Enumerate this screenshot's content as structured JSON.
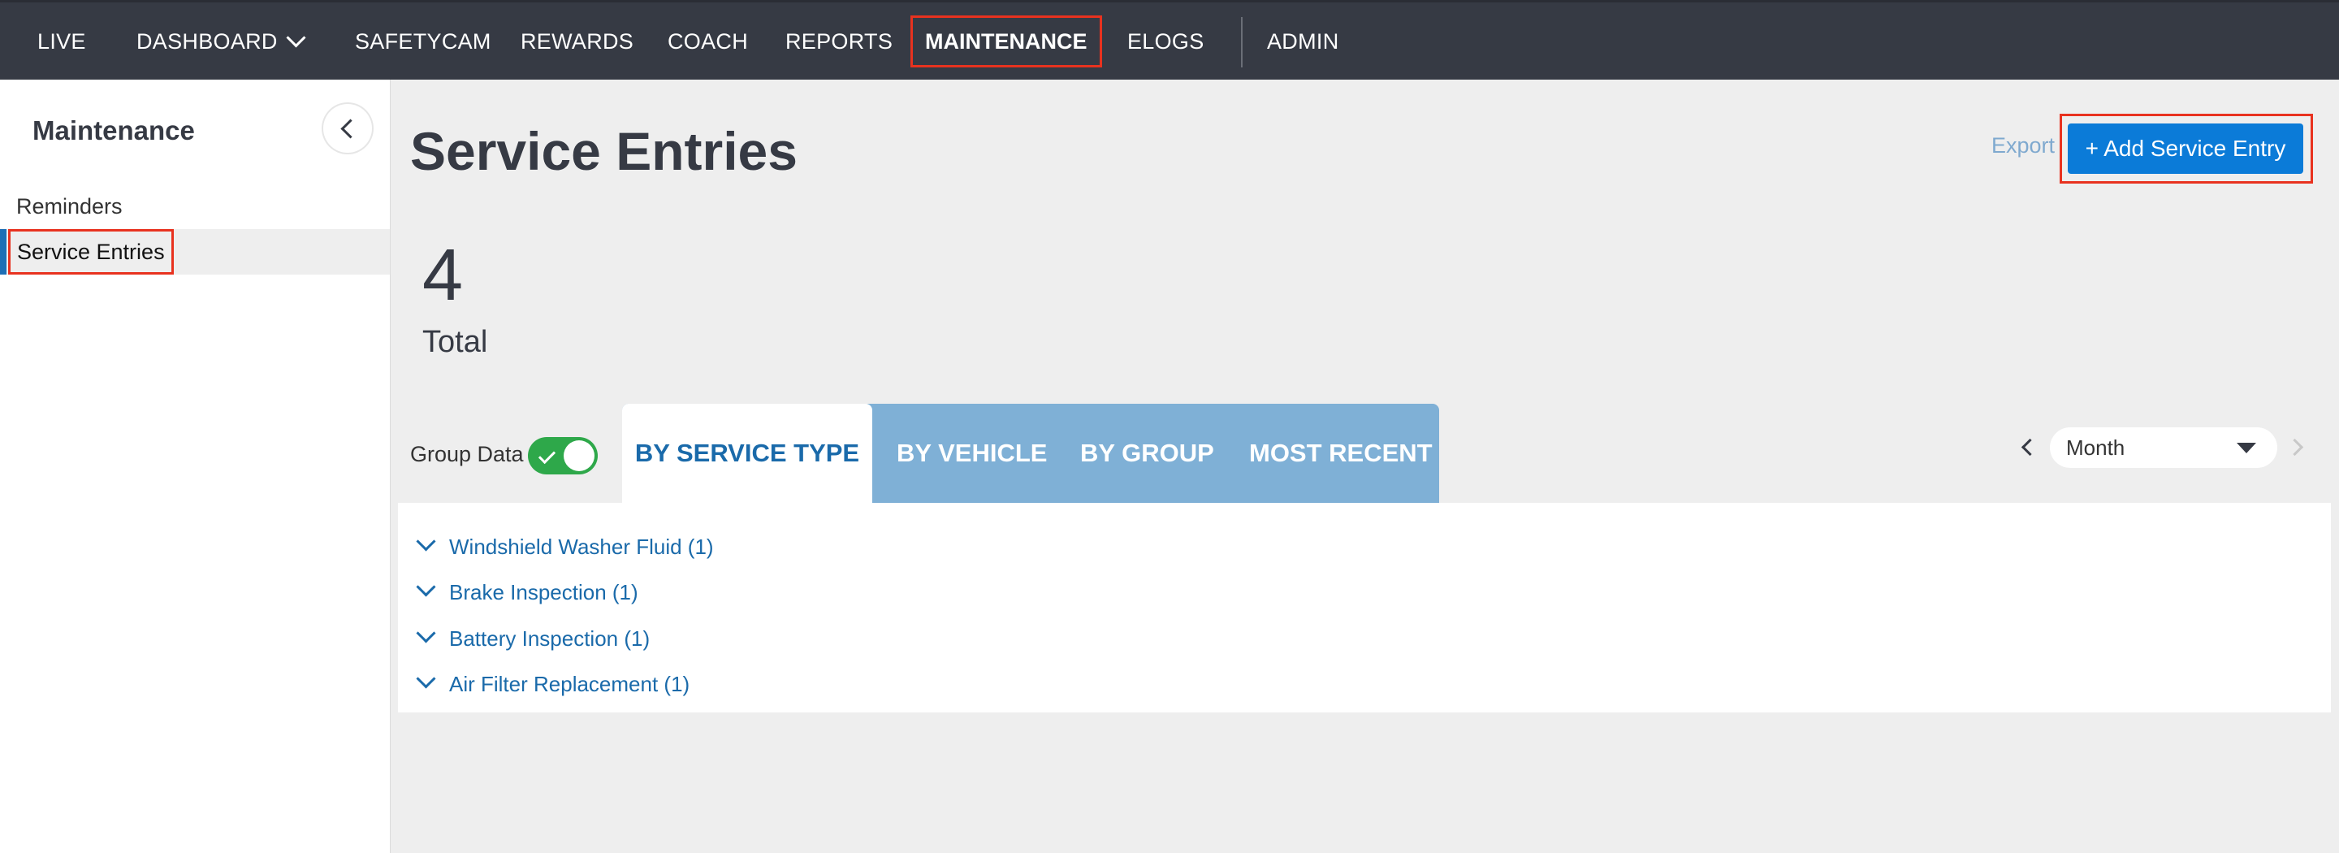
{
  "nav": {
    "items": [
      {
        "label": "LIVE"
      },
      {
        "label": "DASHBOARD"
      },
      {
        "label": "SAFETYCAM"
      },
      {
        "label": "REWARDS"
      },
      {
        "label": "COACH"
      },
      {
        "label": "REPORTS"
      },
      {
        "label": "MAINTENANCE",
        "active": true
      },
      {
        "label": "ELOGS"
      },
      {
        "label": "ADMIN"
      }
    ]
  },
  "sidebar": {
    "title": "Maintenance",
    "items": [
      {
        "label": "Reminders"
      },
      {
        "label": "Service Entries",
        "active": true
      }
    ]
  },
  "main": {
    "title": "Service Entries",
    "export_label": "Export",
    "add_button_label": "+ Add Service Entry",
    "total_value": "4",
    "total_label": "Total",
    "group_data_label": "Group Data",
    "group_data_on": true,
    "tabs": [
      {
        "label": "BY SERVICE TYPE",
        "active": true
      },
      {
        "label": "BY VEHICLE"
      },
      {
        "label": "BY GROUP"
      },
      {
        "label": "MOST RECENT"
      }
    ],
    "period": {
      "selected": "Month"
    },
    "groups": [
      {
        "label": "Windshield Washer Fluid (1)"
      },
      {
        "label": "Brake Inspection (1)"
      },
      {
        "label": "Battery Inspection (1)"
      },
      {
        "label": "Air Filter Replacement (1)"
      }
    ]
  },
  "colors": {
    "nav_bg": "#363a44",
    "accent_blue": "#0b7bd8",
    "highlight_red": "#e8321f",
    "toggle_green": "#2ea84a",
    "tab_bar": "#7fb0d6"
  }
}
